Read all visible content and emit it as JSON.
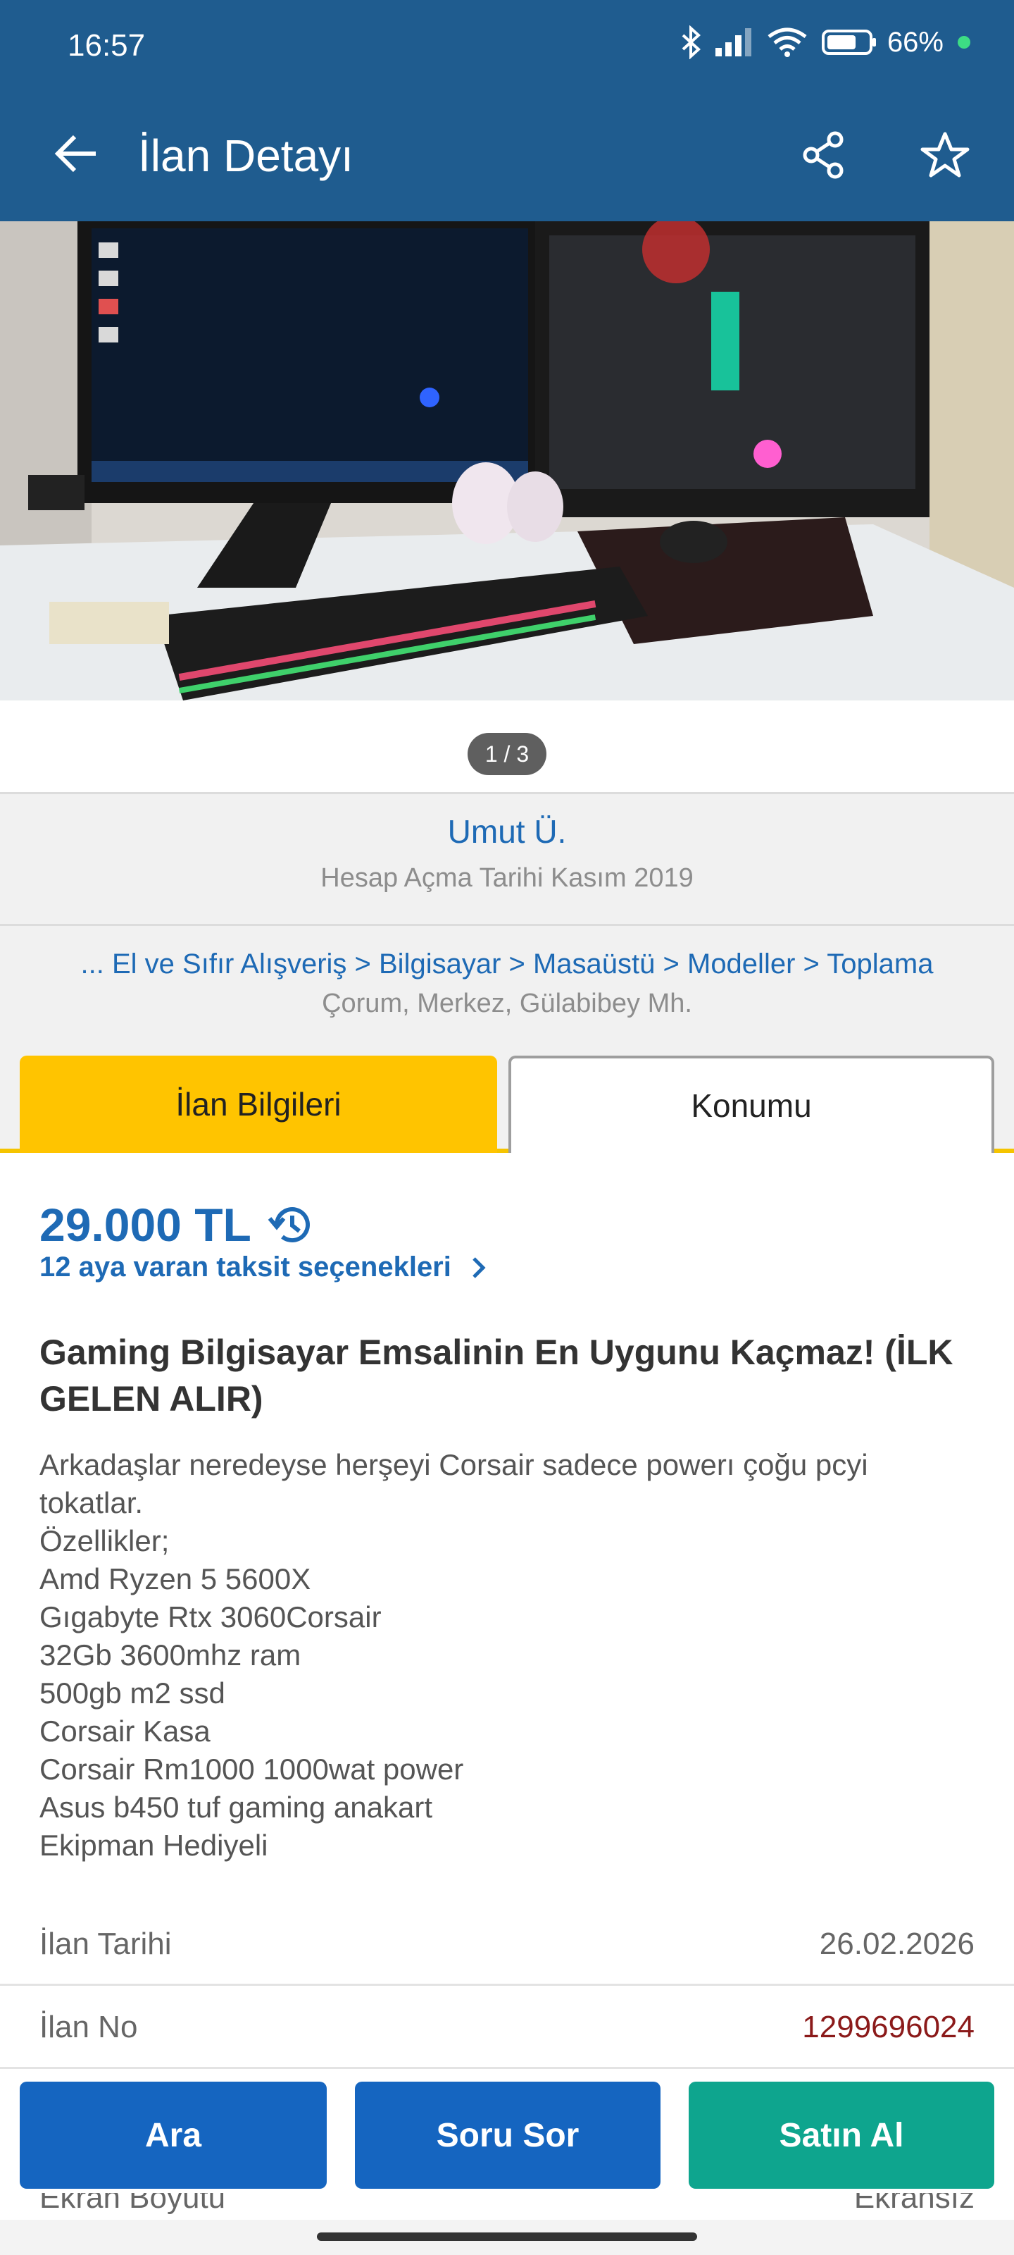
{
  "status_bar": {
    "time": "16:57",
    "battery": "66%",
    "icons": [
      "bluetooth-icon",
      "signal-icon",
      "wifi-icon",
      "battery-icon",
      "dot-icon"
    ]
  },
  "app_bar": {
    "title": "İlan Detayı",
    "icons": [
      "back-arrow-icon",
      "share-icon",
      "star-icon"
    ]
  },
  "gallery": {
    "counter": "1 / 3"
  },
  "seller": {
    "name": "Umut Ü.",
    "since": "Hesap Açma Tarihi Kasım 2019"
  },
  "breadcrumb": {
    "path": "... El ve Sıfır Alışveriş > Bilgisayar > Masaüstü > Modeller > Toplama",
    "location": "Çorum, Merkez, Gülabibey Mh."
  },
  "tabs": [
    {
      "label": "İlan Bilgileri",
      "active": true
    },
    {
      "label": "Konumu",
      "active": false
    }
  ],
  "listing": {
    "price": "29.000 TL",
    "installment": "12 aya varan taksit seçenekleri",
    "title": "Gaming Bilgisayar Emsalinin En Uygunu Kaçmaz! (İLK GELEN ALIR)",
    "description": [
      "Arkadaşlar neredeyse herşeyi Corsair sadece powerı çoğu pcyi",
      "tokatlar.",
      "Özellikler;",
      "Amd Ryzen 5 5600X",
      "Gıgabyte Rtx 3060Corsair",
      "32Gb 3600mhz ram",
      "500gb m2 ssd",
      "Corsair Kasa",
      "Corsair Rm1000 1000wat power",
      "Asus b450 tuf gaming anakart",
      "Ekipman Hediyeli"
    ]
  },
  "details": [
    {
      "label": "İlan Tarihi",
      "value": "26.02.2026"
    },
    {
      "label": "İlan No",
      "value": "1299696024"
    },
    {
      "label": "Ekran Boyutu",
      "value": "Ekransız"
    }
  ],
  "actions": {
    "call": "Ara",
    "ask": "Soru Sor",
    "buy": "Satın Al"
  },
  "colors": {
    "header": "#1f5c8f",
    "link_blue": "#1e6ab5",
    "tab_yellow": "#ffc400",
    "button_blue": "#1565c0",
    "button_green": "#0ea58e",
    "listing_no_red": "#8b1a1a"
  }
}
